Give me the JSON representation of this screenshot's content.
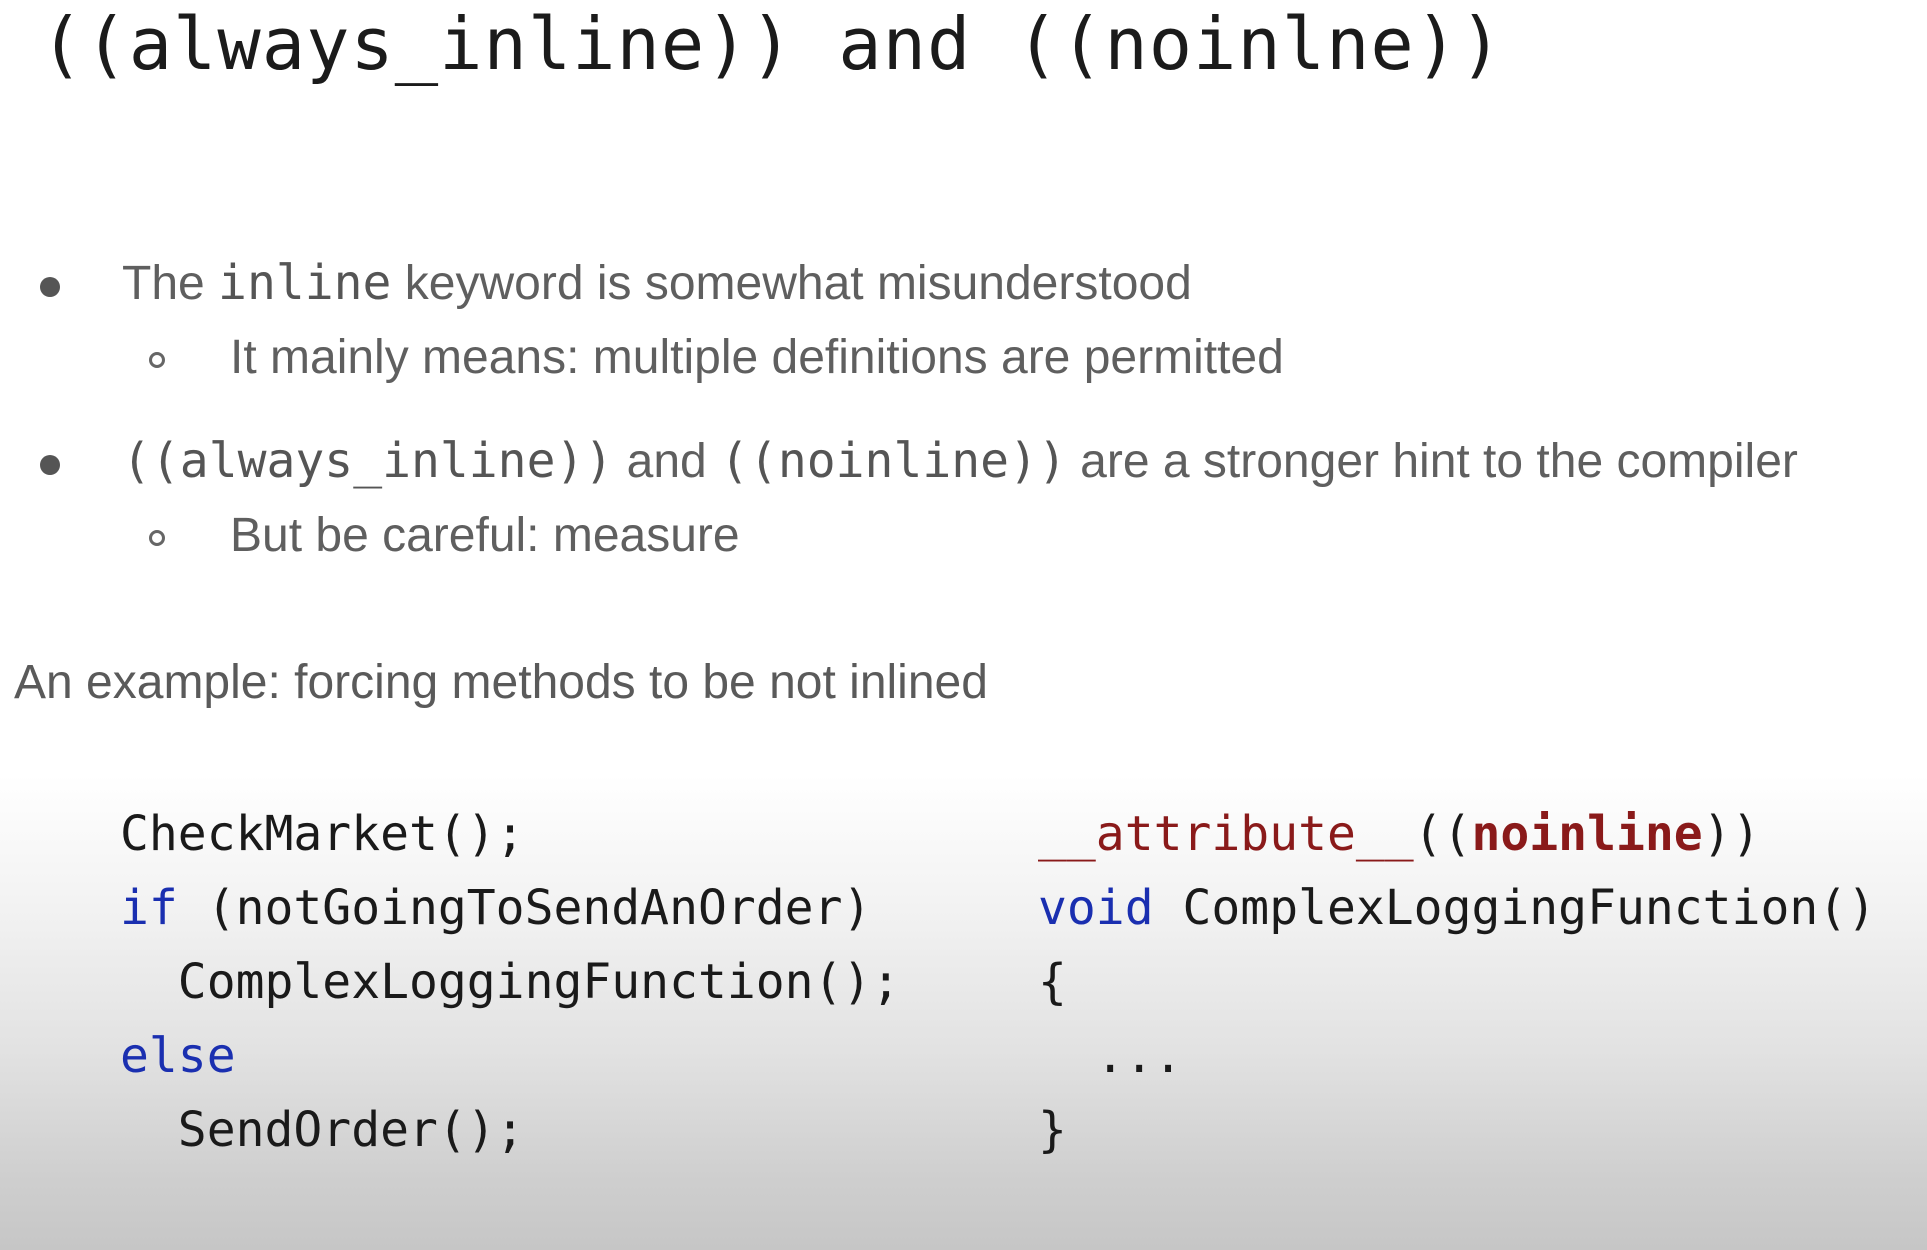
{
  "slide": {
    "title": "((always_inline)) and ((noinlne))",
    "bullets": [
      {
        "text_before": "The ",
        "code": "inline",
        "text_after": " keyword is somewhat misunderstood",
        "sub": "It mainly means: multiple definitions are permitted"
      },
      {
        "code1": "((always_inline))",
        "mid": " and ",
        "code2": "((noinline))",
        "text_after": " are a stronger hint to the compiler",
        "sub": "But be careful: measure"
      }
    ],
    "example_label": "An example: forcing methods to be not inlined",
    "left_code": {
      "line1": "CheckMarket();",
      "line2_kw": "if",
      "line2_rest": " (notGoingToSendAnOrder)",
      "line3": "  ComplexLoggingFunction();",
      "line4_kw": "else",
      "line5": "  SendOrder();"
    },
    "right_code": {
      "attr": "__attribute__",
      "open": "((",
      "noinline": "noinline",
      "close": "))",
      "void_kw": "void",
      "func": " ComplexLoggingFunction()",
      "brace_open": "{",
      "ellipsis": "  ...",
      "brace_close": "}"
    }
  }
}
